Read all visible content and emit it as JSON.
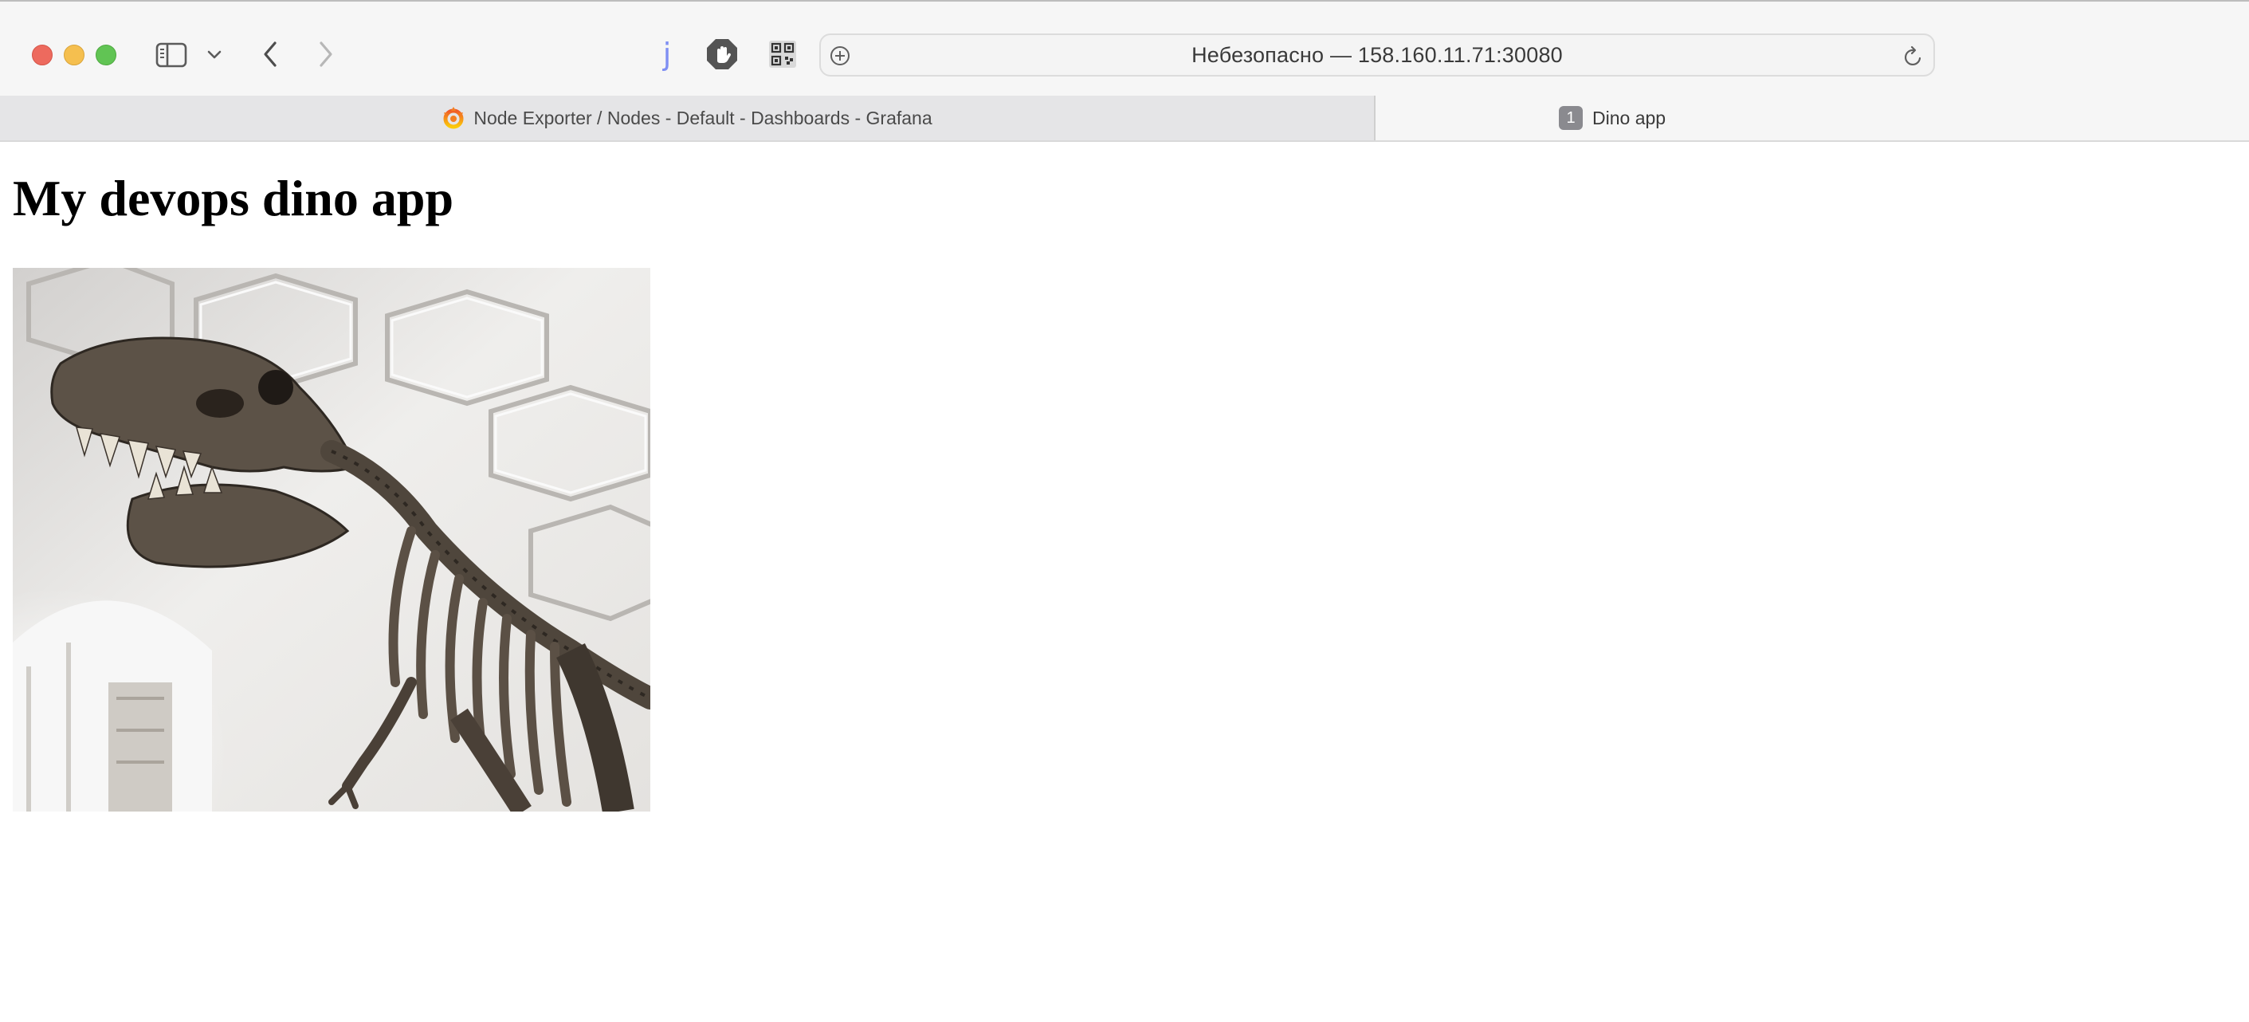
{
  "window": {
    "controls": [
      "close",
      "minimize",
      "zoom"
    ]
  },
  "toolbar": {
    "icons": [
      "sidebar-icon",
      "chevron-down-icon",
      "back-icon",
      "forward-icon",
      "jsonview-extension-icon",
      "stop-hand-extension-icon",
      "qr-code-extension-icon",
      "add-icon",
      "reload-icon"
    ],
    "extension_letter": "j",
    "address": "Небезопасно — 158.160.11.71:30080"
  },
  "tabs": [
    {
      "label": "Node Exporter / Nodes - Default - Dashboards - Grafana",
      "icon": "grafana-icon",
      "active": false
    },
    {
      "label": "Dino app",
      "badge": "1",
      "active": true
    }
  ],
  "page": {
    "heading": "My devops dino app",
    "image": "t-rex-skeleton-photo"
  },
  "colors": {
    "close": "#ed6a5e",
    "minimize": "#f5bf4f",
    "zoom": "#61c454",
    "grafana_orange": "#f37e22"
  }
}
